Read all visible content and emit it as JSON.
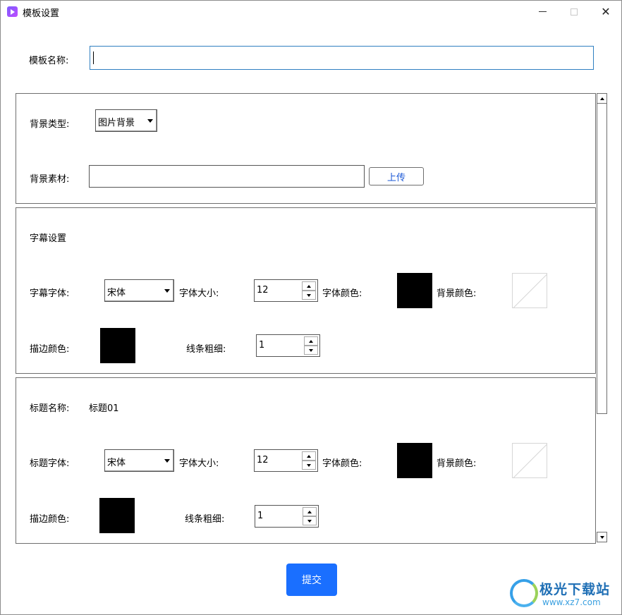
{
  "window": {
    "title": "模板设置",
    "controls": {
      "minimize": "—",
      "maximize": "☐",
      "close": "✕"
    }
  },
  "template_name": {
    "label": "模板名称:",
    "value": ""
  },
  "background": {
    "type_label": "背景类型:",
    "type_value": "图片背景",
    "material_label": "背景素材:",
    "material_value": "",
    "upload_label": "上传"
  },
  "subtitle": {
    "section_title": "字幕设置",
    "font_label": "字幕字体:",
    "font_value": "宋体",
    "size_label": "字体大小:",
    "size_value": "12",
    "font_color_label": "字体颜色:",
    "font_color": "#000000",
    "bg_color_label": "背景颜色:",
    "bg_color": "none",
    "stroke_color_label": "描边颜色:",
    "stroke_color": "#000000",
    "line_width_label": "线条粗细:",
    "line_width_value": "1"
  },
  "title_section": {
    "name_label": "标题名称:",
    "name_value": "标题01",
    "font_label": "标题字体:",
    "font_value": "宋体",
    "size_label": "字体大小:",
    "size_value": "12",
    "font_color_label": "字体颜色:",
    "font_color": "#000000",
    "bg_color_label": "背景颜色:",
    "bg_color": "none",
    "stroke_color_label": "描边颜色:",
    "stroke_color": "#000000",
    "line_width_label": "线条粗细:",
    "line_width_value": "1"
  },
  "submit_label": "提交",
  "watermark": {
    "title": "极光下载站",
    "url": "www.xz7.com"
  },
  "colors": {
    "accent": "#1a6fff",
    "focus_border": "#2f7fc1",
    "link": "#1a57d6"
  }
}
